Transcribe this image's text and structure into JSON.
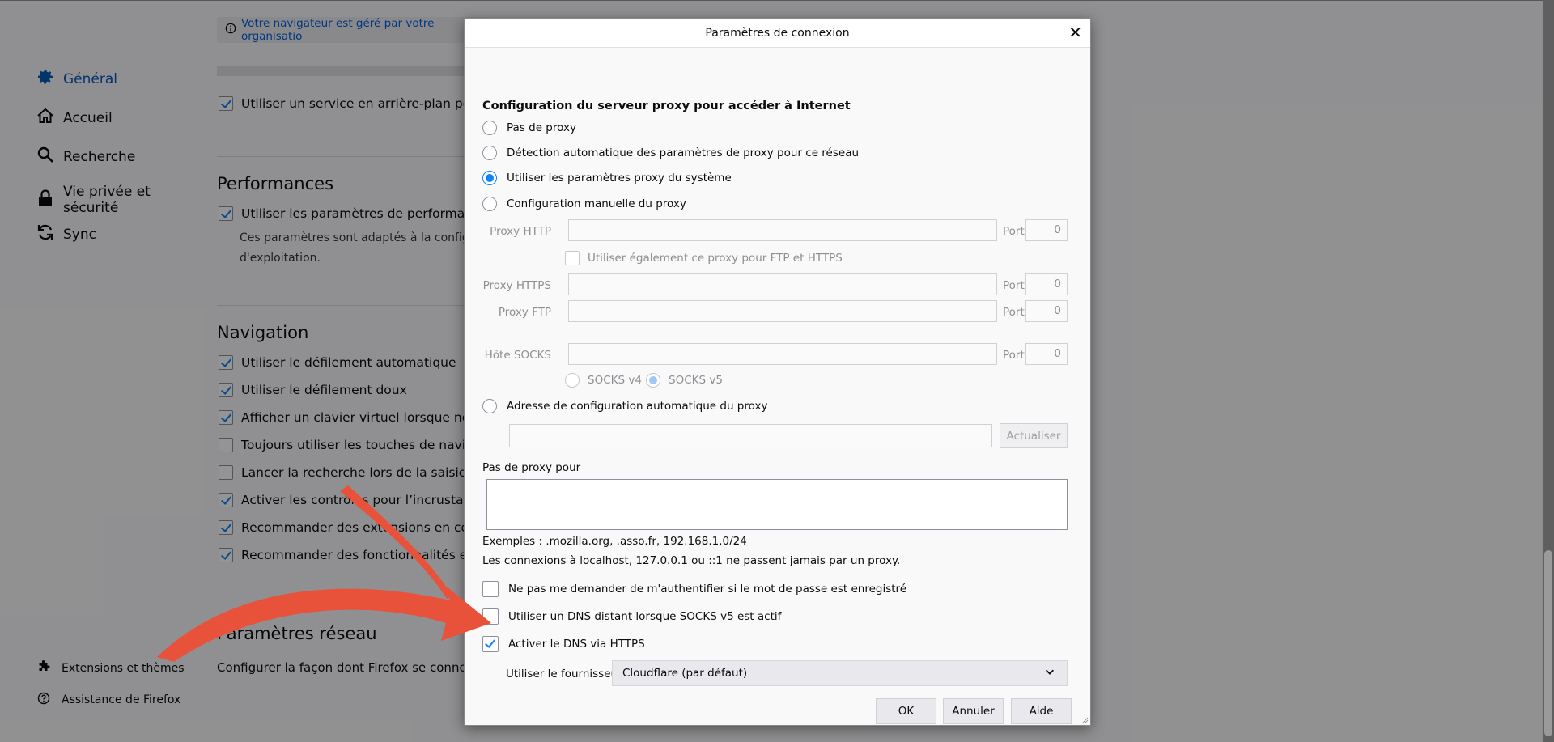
{
  "sidebar": {
    "items": [
      {
        "label": "Général",
        "icon": "gear-icon"
      },
      {
        "label": "Accueil",
        "icon": "home-icon"
      },
      {
        "label": "Recherche",
        "icon": "search-icon"
      },
      {
        "label": "Vie privée et sécurité",
        "icon": "lock-icon"
      },
      {
        "label": "Sync",
        "icon": "sync-icon"
      }
    ],
    "bottom": [
      {
        "label": "Extensions et thèmes",
        "icon": "puzzle-icon"
      },
      {
        "label": "Assistance de Firefox",
        "icon": "help-icon"
      }
    ]
  },
  "settings": {
    "managed_notice": "Votre navigateur est géré par votre organisatio",
    "background_service": "Utiliser un service en arrière-plan pour inst",
    "performance": {
      "heading": "Performances",
      "recommended": "Utiliser les paramètres de performance rec",
      "description_1": "Ces paramètres sont adaptés à la configurati",
      "description_2": "d'exploitation."
    },
    "navigation": {
      "heading": "Navigation",
      "items": [
        {
          "label": "Utiliser le défilement automatique",
          "checked": true
        },
        {
          "label": "Utiliser le défilement doux",
          "checked": true
        },
        {
          "label": "Afficher un clavier virtuel lorsque nécessai",
          "checked": true
        },
        {
          "label": "Toujours utiliser les touches de navigation",
          "checked": false
        },
        {
          "label": "Lancer la recherche lors de la saisie de tex",
          "checked": false
        },
        {
          "label": "Activer les contrôles pour l’incrustation vid",
          "checked": true
        },
        {
          "label": "Recommander des extensions en cours de",
          "checked": true
        },
        {
          "label": "Recommander des fonctionnalités en cour",
          "checked": true
        }
      ]
    },
    "network": {
      "heading": "Paramètres réseau",
      "description": "Configurer la façon dont Firefox se connecte à"
    }
  },
  "dialog": {
    "title": "Paramètres de connexion",
    "section_title": "Configuration du serveur proxy pour accéder à Internet",
    "proxy_options": [
      {
        "label": "Pas de proxy",
        "checked": false
      },
      {
        "label": "Détection automatique des paramètres de proxy pour ce réseau",
        "checked": false
      },
      {
        "label": "Utiliser les paramètres proxy du système",
        "checked": true
      },
      {
        "label": "Configuration manuelle du proxy",
        "checked": false
      }
    ],
    "http_label": "Proxy HTTP",
    "https_label": "Proxy HTTPS",
    "ftp_label": "Proxy FTP",
    "socks_label": "Hôte SOCKS",
    "port_label": "Port",
    "port_http": "0",
    "port_https": "0",
    "port_ftp": "0",
    "port_socks": "0",
    "also_use_label": "Utiliser également ce proxy pour FTP et HTTPS",
    "socks_v4": "SOCKS v4",
    "socks_v5": "SOCKS v5",
    "auto_config_label": "Adresse de configuration automatique du proxy",
    "reload_button": "Actualiser",
    "no_proxy_label": "Pas de proxy pour",
    "examples": "Exemples : .mozilla.org, .asso.fr, 192.168.1.0/24",
    "localhost_note": "Les connexions à localhost, 127.0.0.1 ou ::1 ne passent jamais par un proxy.",
    "no_auth_prompt": {
      "label": "Ne pas me demander de m'authentifier si le mot de passe est enregistré",
      "checked": false
    },
    "remote_dns": {
      "label": "Utiliser un DNS distant lorsque SOCKS v5 est actif",
      "checked": false
    },
    "dns_https": {
      "label": "Activer le DNS via HTTPS",
      "checked": true
    },
    "provider_label": "Utiliser le fournisseur",
    "provider_value": "Cloudflare (par défaut)",
    "ok_button": "OK",
    "cancel_button": "Annuler",
    "help_button": "Aide"
  },
  "colors": {
    "accent": "#0a84ff",
    "annotation_arrow": "#e8523a",
    "overlay": "#000000"
  }
}
